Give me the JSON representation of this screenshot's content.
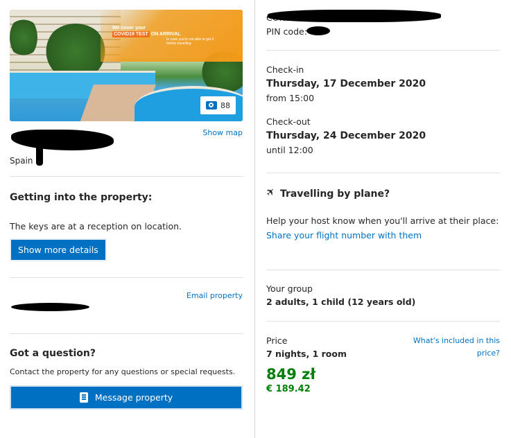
{
  "hotel": {
    "photo_count": "88",
    "banner": {
      "line1": "We cover your",
      "tag": "COVID19 TEST",
      "line2": "ON ARRIVAL",
      "small": "In case you're not able to get it before travelling"
    },
    "show_map_label": "Show map",
    "country": "Spain"
  },
  "getting_in": {
    "title": "Getting into the property:",
    "text": "The keys are at a reception on location.",
    "button_label": "Show more details"
  },
  "contact": {
    "email_label": "Email property"
  },
  "question": {
    "title": "Got a question?",
    "text": "Contact the property for any questions or special requests.",
    "button_label": "Message property"
  },
  "booking": {
    "confirmation_prefix": "CONFIRMAT",
    "pin_label": "PIN code:",
    "checkin": {
      "label": "Check-in",
      "date": "Thursday, 17 December 2020",
      "time": "from 15:00"
    },
    "checkout": {
      "label": "Check-out",
      "date": "Thursday, 24 December 2020",
      "time": "until 12:00"
    }
  },
  "travel": {
    "title": "Travelling by plane?",
    "text": "Help your host know when you'll arrive at their place:",
    "link": "Share your flight number with them"
  },
  "group": {
    "label": "Your group",
    "value": "2 adults, 1 child (12 years old)"
  },
  "price": {
    "label": "Price",
    "nights": "7 nights, 1 room",
    "included_link_line1": "What's included in this",
    "included_link_line2": "price?",
    "amount": "849 zł",
    "amount_eur": "€ 189.42"
  }
}
